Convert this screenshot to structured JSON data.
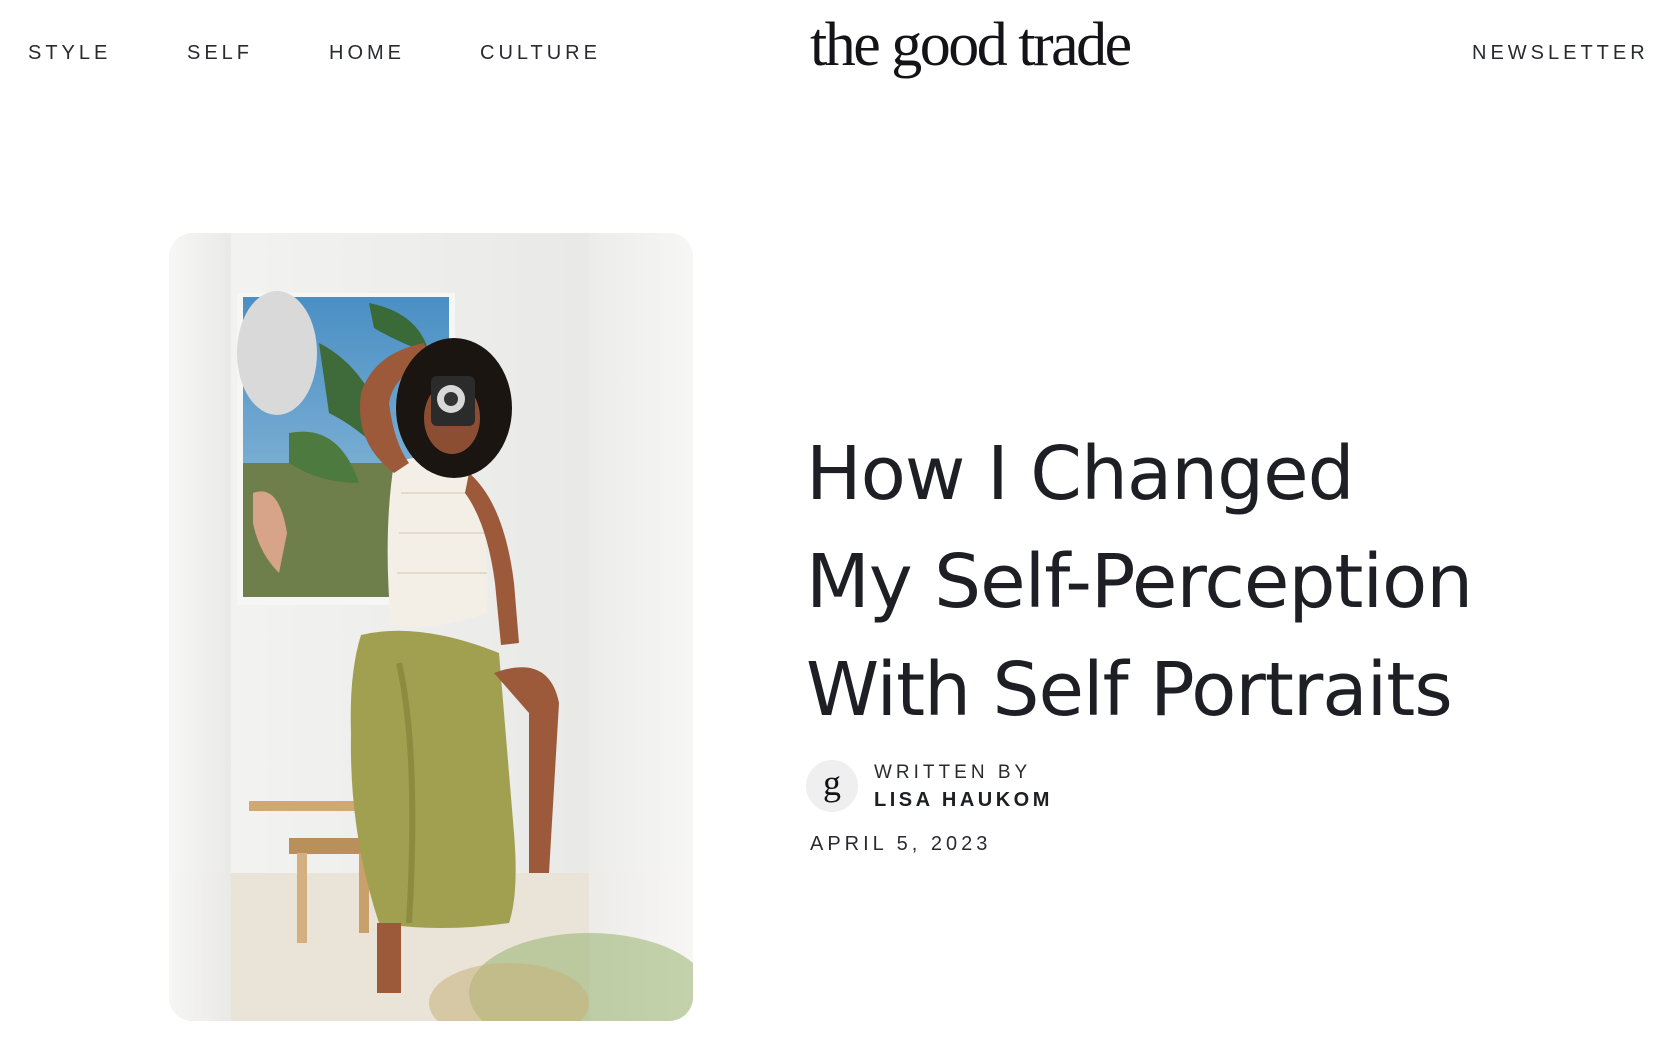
{
  "nav": {
    "left": [
      "STYLE",
      "SELF",
      "HOME",
      "CULTURE"
    ],
    "logo": "the good trade",
    "right": "NEWSLETTER"
  },
  "article": {
    "title_lines": [
      "How I Changed",
      "My Self-Perception",
      "With Self Portraits"
    ],
    "avatar_letter": "g",
    "written_by_label": "WRITTEN BY",
    "author": "LISA HAUKOM",
    "date": "APRIL 5, 2023"
  },
  "hero_image": {
    "description_icon": "woman-with-camera-photo"
  }
}
